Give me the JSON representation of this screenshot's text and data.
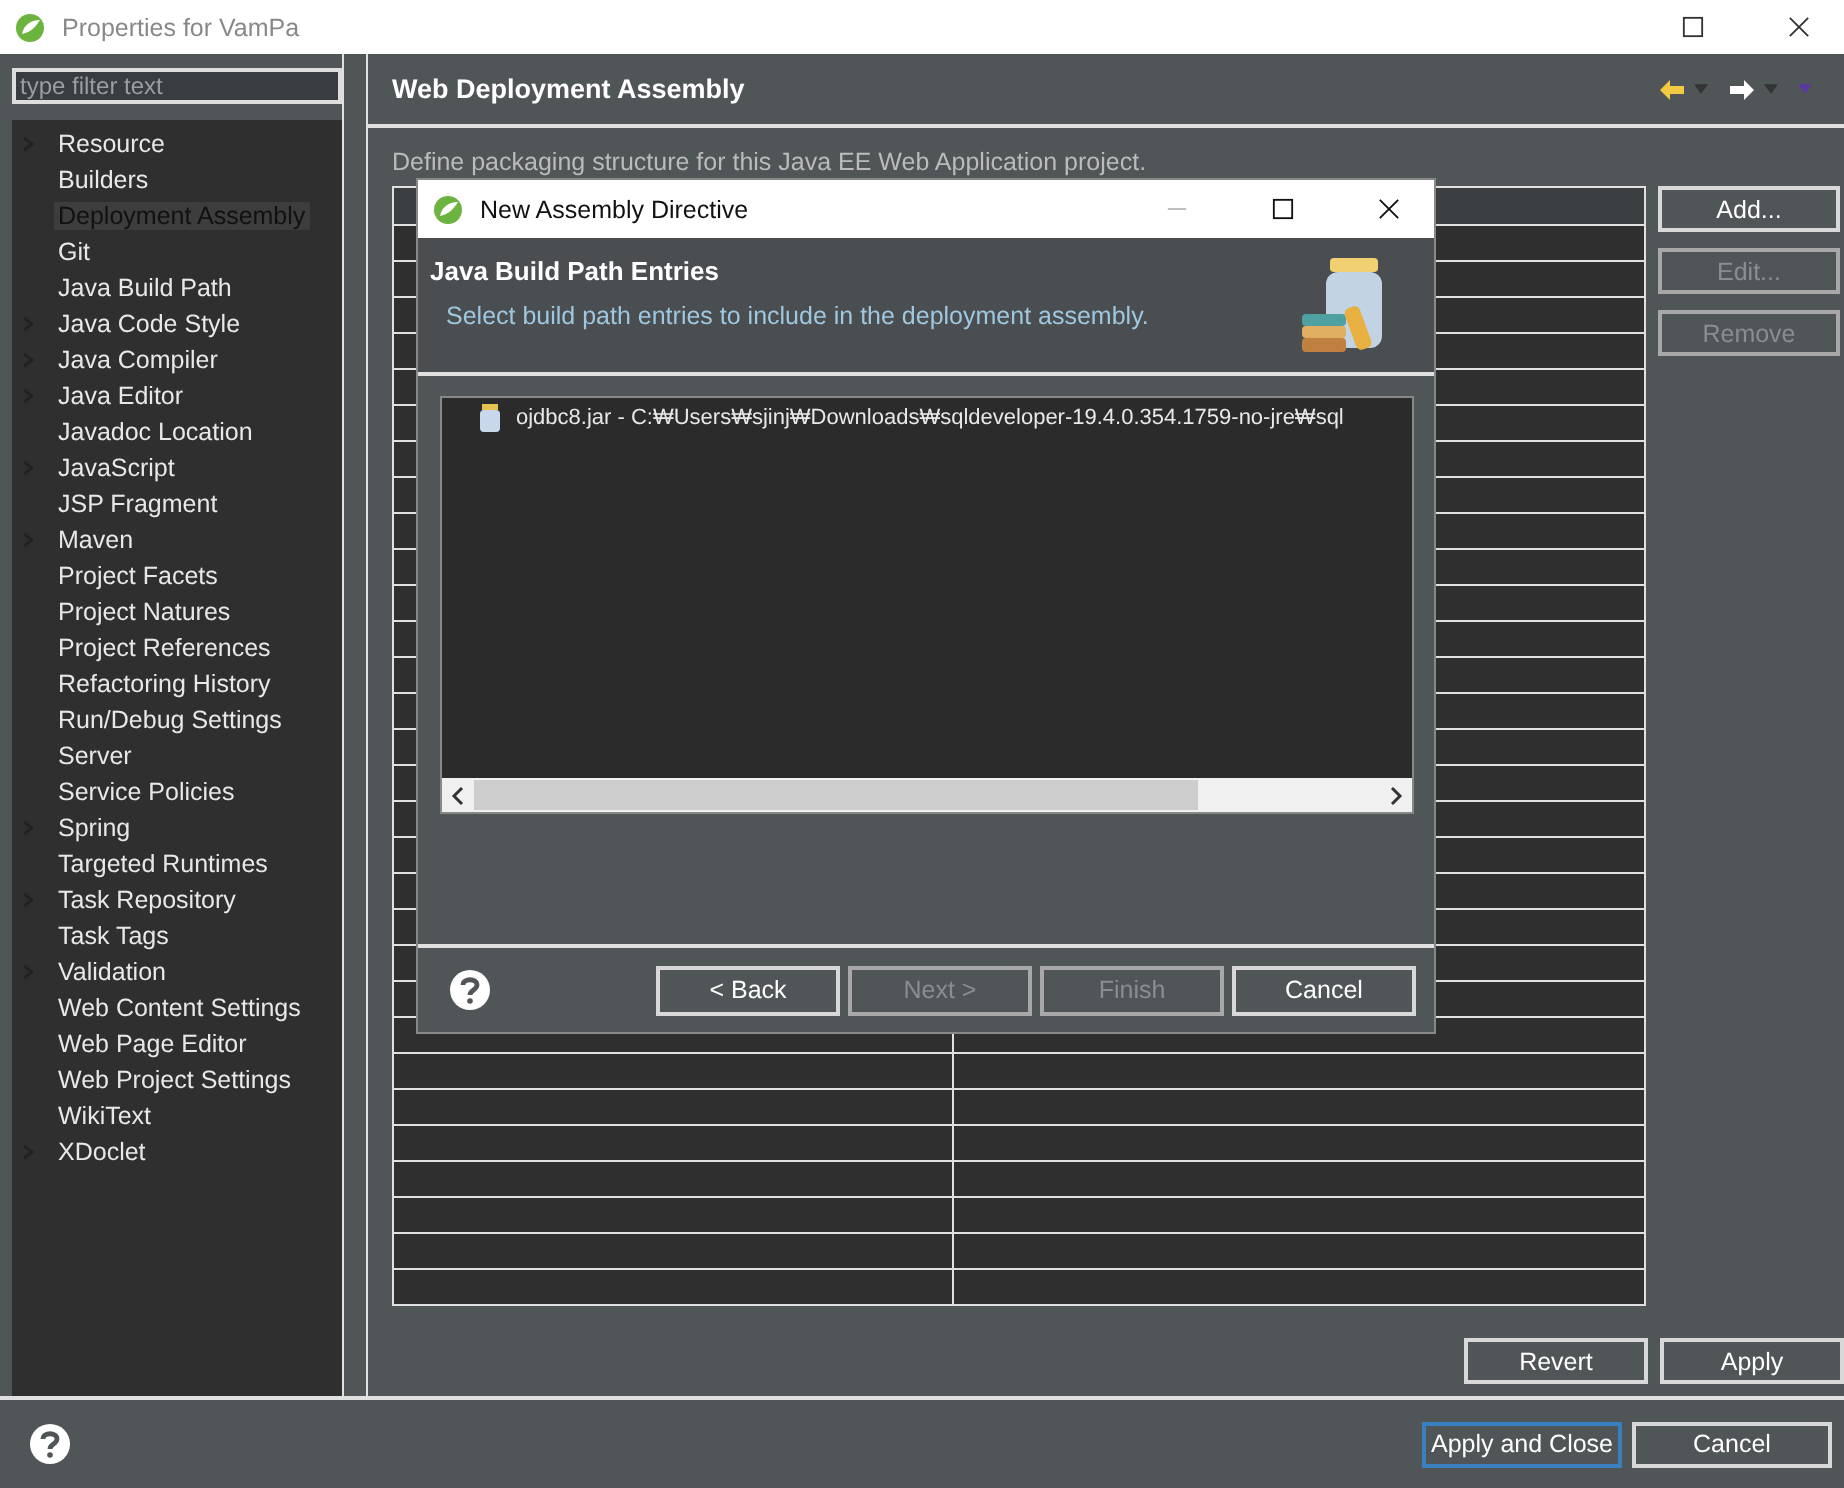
{
  "window": {
    "title": "Properties for VamPa"
  },
  "sidebar": {
    "filter": {
      "placeholder": "type filter text"
    },
    "items": [
      {
        "label": "Resource",
        "expandable": true,
        "selected": false
      },
      {
        "label": "Builders",
        "expandable": false,
        "selected": false
      },
      {
        "label": "Deployment Assembly",
        "expandable": false,
        "selected": true
      },
      {
        "label": "Git",
        "expandable": false,
        "selected": false
      },
      {
        "label": "Java Build Path",
        "expandable": false,
        "selected": false
      },
      {
        "label": "Java Code Style",
        "expandable": true,
        "selected": false
      },
      {
        "label": "Java Compiler",
        "expandable": true,
        "selected": false
      },
      {
        "label": "Java Editor",
        "expandable": true,
        "selected": false
      },
      {
        "label": "Javadoc Location",
        "expandable": false,
        "selected": false
      },
      {
        "label": "JavaScript",
        "expandable": true,
        "selected": false
      },
      {
        "label": "JSP Fragment",
        "expandable": false,
        "selected": false
      },
      {
        "label": "Maven",
        "expandable": true,
        "selected": false
      },
      {
        "label": "Project Facets",
        "expandable": false,
        "selected": false
      },
      {
        "label": "Project Natures",
        "expandable": false,
        "selected": false
      },
      {
        "label": "Project References",
        "expandable": false,
        "selected": false
      },
      {
        "label": "Refactoring History",
        "expandable": false,
        "selected": false
      },
      {
        "label": "Run/Debug Settings",
        "expandable": false,
        "selected": false
      },
      {
        "label": "Server",
        "expandable": false,
        "selected": false
      },
      {
        "label": "Service Policies",
        "expandable": false,
        "selected": false
      },
      {
        "label": "Spring",
        "expandable": true,
        "selected": false
      },
      {
        "label": "Targeted Runtimes",
        "expandable": false,
        "selected": false
      },
      {
        "label": "Task Repository",
        "expandable": true,
        "selected": false
      },
      {
        "label": "Task Tags",
        "expandable": false,
        "selected": false
      },
      {
        "label": "Validation",
        "expandable": true,
        "selected": false
      },
      {
        "label": "Web Content Settings",
        "expandable": false,
        "selected": false
      },
      {
        "label": "Web Page Editor",
        "expandable": false,
        "selected": false
      },
      {
        "label": "Web Project Settings",
        "expandable": false,
        "selected": false
      },
      {
        "label": "WikiText",
        "expandable": false,
        "selected": false
      },
      {
        "label": "XDoclet",
        "expandable": true,
        "selected": false
      }
    ]
  },
  "page": {
    "title": "Web Deployment Assembly",
    "description": "Define packaging structure for this Java EE Web Application project.",
    "side_buttons": [
      {
        "label": "Add...",
        "disabled": false
      },
      {
        "label": "Edit...",
        "disabled": true
      },
      {
        "label": "Remove",
        "disabled": true
      }
    ],
    "buttons": [
      {
        "label": "Revert",
        "disabled": false
      },
      {
        "label": "Apply",
        "disabled": false
      }
    ]
  },
  "dialog": {
    "title": "New Assembly Directive",
    "heading": "Java Build Path Entries",
    "subtitle": "Select build path entries to include in the deployment assembly.",
    "entries": [
      {
        "label": "ojdbc8.jar - C:₩Users₩sjinj₩Downloads₩sqldeveloper-19.4.0.354.1759-no-jre₩sql"
      }
    ],
    "buttons": [
      {
        "label": "< Back",
        "disabled": false
      },
      {
        "label": "Next >",
        "disabled": true
      },
      {
        "label": "Finish",
        "disabled": true
      },
      {
        "label": "Cancel",
        "disabled": false
      }
    ]
  },
  "footer_buttons": [
    {
      "label": "Apply and Close",
      "default": true
    },
    {
      "label": "Cancel",
      "default": false
    }
  ]
}
